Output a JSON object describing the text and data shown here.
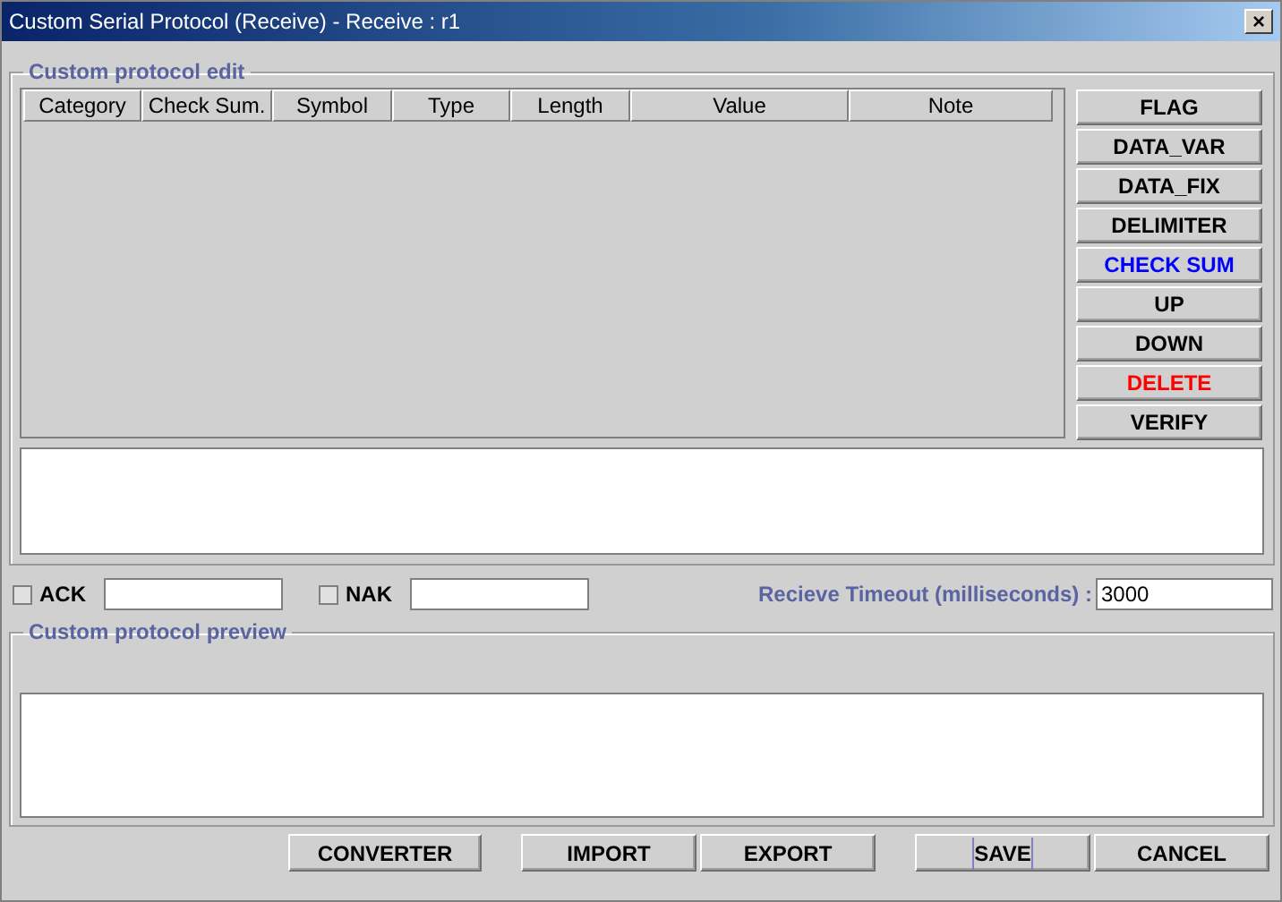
{
  "window": {
    "title": "Custom Serial Protocol (Receive) - Receive : r1",
    "close": "×"
  },
  "edit_group": {
    "title": "Custom protocol edit",
    "table": {
      "columns": [
        {
          "label": "Category"
        },
        {
          "label": "Check Sum."
        },
        {
          "label": "Symbol"
        },
        {
          "label": "Type"
        },
        {
          "label": "Length"
        },
        {
          "label": "Value"
        },
        {
          "label": "Note"
        }
      ]
    },
    "buttons": [
      {
        "label": "FLAG",
        "color": "#000000"
      },
      {
        "label": "DATA_VAR",
        "color": "#000000"
      },
      {
        "label": "DATA_FIX",
        "color": "#000000"
      },
      {
        "label": "DELIMITER",
        "color": "#000000"
      },
      {
        "label": "CHECK SUM",
        "color": "#0000ff"
      },
      {
        "label": "UP",
        "color": "#000000"
      },
      {
        "label": "DOWN",
        "color": "#000000"
      },
      {
        "label": "DELETE",
        "color": "#ff0000"
      },
      {
        "label": "VERIFY",
        "color": "#000000"
      }
    ]
  },
  "ack": {
    "label": "ACK",
    "checked": false
  },
  "nak": {
    "label": "NAK",
    "checked": false
  },
  "timeout": {
    "label": "Recieve Timeout (milliseconds) :",
    "value": "3000"
  },
  "preview_group": {
    "title": "Custom protocol preview"
  },
  "bottom_buttons": [
    {
      "label": "CONVERTER",
      "focused": false
    },
    {
      "label": "IMPORT",
      "focused": false
    },
    {
      "label": "EXPORT",
      "focused": false
    },
    {
      "label": "SAVE",
      "focused": true
    },
    {
      "label": "CANCEL",
      "focused": false
    }
  ]
}
